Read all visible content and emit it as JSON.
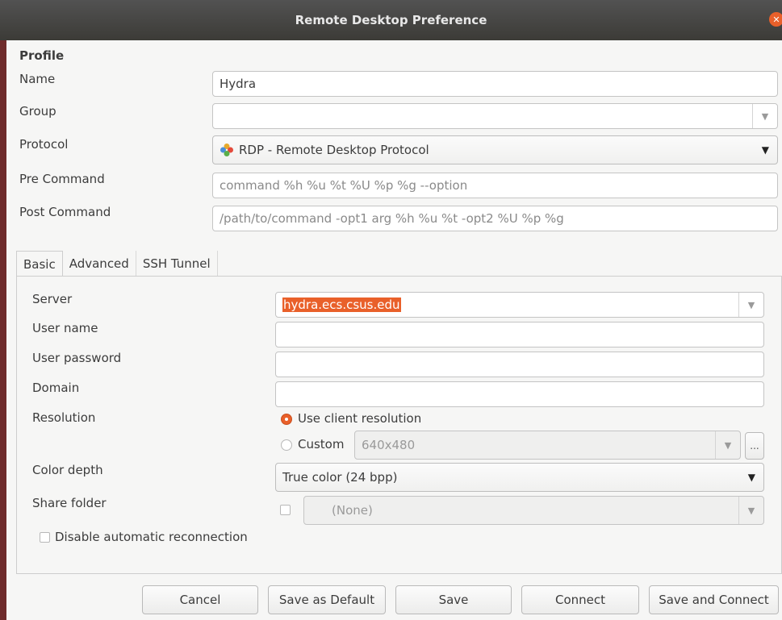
{
  "window": {
    "title": "Remote Desktop Preference"
  },
  "profile": {
    "heading": "Profile",
    "name_label": "Name",
    "name_value": "Hydra",
    "group_label": "Group",
    "group_value": "",
    "protocol_label": "Protocol",
    "protocol_value": "RDP - Remote Desktop Protocol",
    "pre_command_label": "Pre Command",
    "pre_command_placeholder": "command %h %u %t %U %p %g --option",
    "post_command_label": "Post Command",
    "post_command_placeholder": "/path/to/command -opt1 arg %h %u %t -opt2 %U %p %g"
  },
  "tabs": [
    {
      "label": "Basic",
      "active": true
    },
    {
      "label": "Advanced",
      "active": false
    },
    {
      "label": "SSH Tunnel",
      "active": false
    }
  ],
  "basic": {
    "server_label": "Server",
    "server_value": "hydra.ecs.csus.edu",
    "username_label": "User name",
    "username_value": "",
    "password_label": "User password",
    "password_value": "",
    "domain_label": "Domain",
    "domain_value": "",
    "resolution_label": "Resolution",
    "resolution_client": "Use client resolution",
    "resolution_custom": "Custom",
    "resolution_custom_value": "640x480",
    "custom_button": "...",
    "color_depth_label": "Color depth",
    "color_depth_value": "True color (24 bpp)",
    "share_folder_label": "Share folder",
    "share_folder_value": "(None)",
    "disable_reconnect_label": "Disable automatic reconnection"
  },
  "buttons": {
    "cancel": "Cancel",
    "save_default": "Save as Default",
    "save": "Save",
    "connect": "Connect",
    "save_connect": "Save and Connect"
  },
  "colors": {
    "accent": "#e9602a",
    "titlebar": "#3c3b37",
    "background": "#f6f6f5"
  }
}
